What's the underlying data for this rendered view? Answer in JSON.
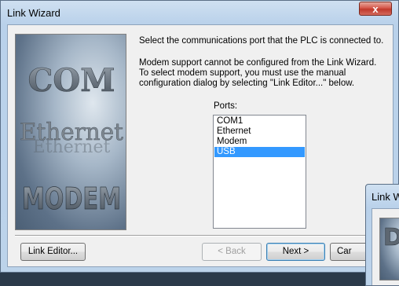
{
  "window": {
    "title": "Link Wizard",
    "close_glyph": "x"
  },
  "side_image": {
    "words": [
      "COM",
      "Ethernet",
      "MODEM"
    ]
  },
  "instructions": {
    "line1": "Select the communications port that the PLC is connected to.",
    "line2": "Modem support cannot be configured from the Link Wizard.",
    "line3": "To select modem support, you must use the manual",
    "line4": "configuration dialog by selecting \"Link Editor...\" below."
  },
  "ports": {
    "label": "Ports:",
    "items": [
      "COM1",
      "Ethernet",
      "Modem",
      "USB"
    ],
    "selected": "USB"
  },
  "buttons": {
    "link_editor": "Link Editor...",
    "back": "< Back",
    "next": "Next >",
    "cancel": "Car"
  },
  "background_window": {
    "title": "Link W",
    "image_text": "D"
  },
  "colors": {
    "selection": "#3399ff",
    "title_bar": "#b9d1ea",
    "close_button": "#c0392b"
  }
}
